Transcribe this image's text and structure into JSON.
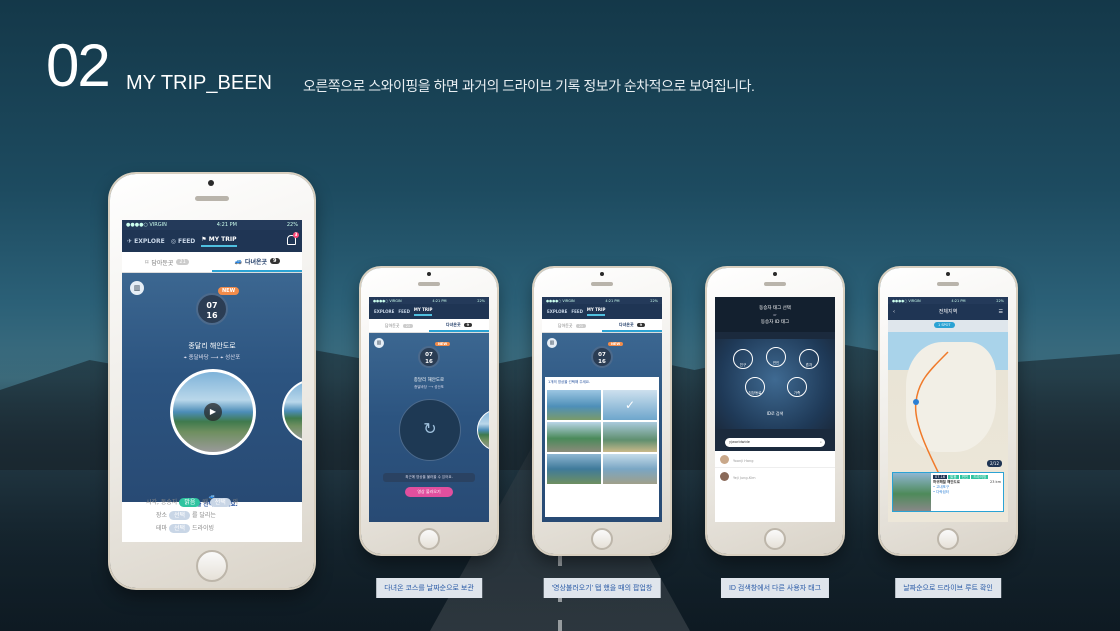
{
  "header": {
    "number": "02",
    "title": "MY TRIP_BEEN",
    "description": "오른쪽으로 스와이핑을 하면 과거의 드라이브 기록 정보가 순차적으로 보여집니다."
  },
  "app": {
    "status_carrier": "●●●●○ VIRGIN",
    "status_time": "4:21 PM",
    "status_battery": "22%",
    "nav": {
      "explore": "EXPLORE",
      "feed": "FEED",
      "mytrip": "MY TRIP",
      "badge": "3"
    },
    "tabs": {
      "saved": "담아둔곳",
      "saved_count": "21",
      "visited": "다녀온곳",
      "visited_count": "9"
    }
  },
  "screen_main": {
    "date_month": "07",
    "date_day": "16",
    "new_tag": "NEW",
    "route_name": "종달리 해안도로",
    "route_from": "종달바당",
    "route_to": "성산포",
    "prompt": "태그를 선택해 주세요.",
    "line1_prefix": "시각, 동승자",
    "line1_tag1": "맑음",
    "line1_mid": "때",
    "line1_tag2": "선택",
    "line1_suffix": "와",
    "line2_prefix": "장소",
    "line2_tag": "선택",
    "line2_suffix": "를 달리는",
    "line3_prefix": "테마",
    "line3_tag": "선택",
    "line3_suffix": "드라이빙"
  },
  "screen1": {
    "date_month": "07",
    "date_day": "16",
    "new_tag": "NEW",
    "route_name": "종달리 해안도로",
    "route_from": "종달바당",
    "route_to": "성산포",
    "hint": "최근에 영상을 불러올 수 있어요.",
    "button": "영상 불러오기"
  },
  "screen2": {
    "date_month": "07",
    "date_day": "16",
    "new_tag": "NEW",
    "title": "1개의 영상을 선택해 주세요."
  },
  "screen3": {
    "title": "동승자 태그 선택",
    "or": "or",
    "subtitle": "동승자 ID 태그",
    "icons": [
      "친구",
      "연인",
      "혼자",
      "직장동료",
      "가족"
    ],
    "search_label": "ID로 검색",
    "search_value": "yjworldwide",
    "users": [
      {
        "id": "yjworldwide",
        "name": "Yoonji Hang"
      },
      {
        "id": "yj",
        "name": "Yeji Jung-Kim"
      }
    ]
  },
  "screen4": {
    "title": "전체지역",
    "chip": "1 SPOT",
    "page": "2/12",
    "card_date": "07.16",
    "card_tag1": "맑음",
    "card_tag2": "연인",
    "card_tag3": "드라이빙",
    "card_title": "하귀해월 해안도로",
    "card_dist": "23 km",
    "card_from": "• 고내포구",
    "card_to": "• 다락쉼터"
  },
  "captions": [
    "다녀온 코스를 날짜순으로 보관",
    "'영상불러오기' 탭 했을 때의 팝업창",
    "ID 검색창에서 다른 사용자 태그",
    "날짜순으로 드라이브 루트 확인"
  ]
}
